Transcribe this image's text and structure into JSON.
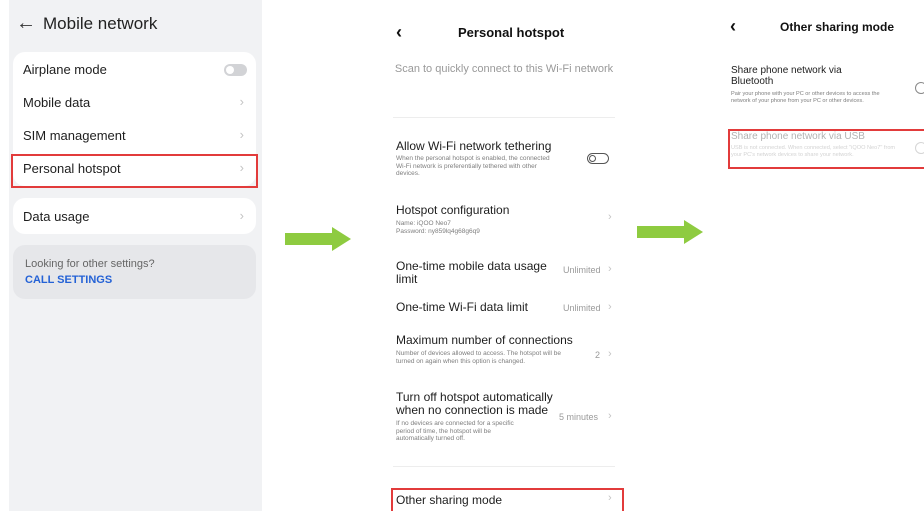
{
  "panel1": {
    "title": "Mobile network",
    "rows": [
      {
        "label": "Airplane mode"
      },
      {
        "label": "Mobile data"
      },
      {
        "label": "SIM management"
      },
      {
        "label": "Personal hotspot"
      },
      {
        "label": "Data usage"
      }
    ],
    "airplane_toggle": "off",
    "other_settings_question": "Looking for other settings?",
    "call_settings_link": "CALL SETTINGS"
  },
  "panel2": {
    "title": "Personal hotspot",
    "scan_text": "Scan to quickly connect to this Wi-Fi network",
    "tethering_title": "Allow Wi-Fi network tethering",
    "tethering_desc": "When the personal hotspot is enabled, the connected Wi-Fi network is preferentially tethered with other devices.",
    "tethering_toggle": "off",
    "config_title": "Hotspot configuration",
    "config_name": "Name: iQOO Neo7",
    "config_password": "Password: ny859lq4g68g6q9",
    "mobile_limit_title": "One-time mobile data usage limit",
    "mobile_limit_value": "Unlimited",
    "wifi_limit_title": "One-time Wi-Fi data limit",
    "wifi_limit_value": "Unlimited",
    "max_conn_title": "Maximum number of connections",
    "max_conn_desc": "Number of devices allowed to access. The hotspot will be turned on again when this option is changed.",
    "max_conn_value": "2",
    "auto_off_title": "Turn off hotspot automatically when no connection is made",
    "auto_off_desc": "If no devices are connected for a specific period of time, the hotspot will be automatically turned off.",
    "auto_off_value": "5 minutes",
    "other_sharing": "Other sharing mode"
  },
  "panel3": {
    "title": "Other sharing mode",
    "bt_title": "Share phone network via Bluetooth",
    "bt_desc": "Pair your phone with your PC or other devices to access the network of your phone from your PC or other devices.",
    "usb_title": "Share phone network via USB",
    "usb_desc": "USB is not connected. When connected, select \"iQOO Neo7\" from your PC's network devices to share your network."
  },
  "colors": {
    "highlight": "#e23b3b",
    "arrow": "#8ecb40",
    "link": "#2462d6"
  }
}
